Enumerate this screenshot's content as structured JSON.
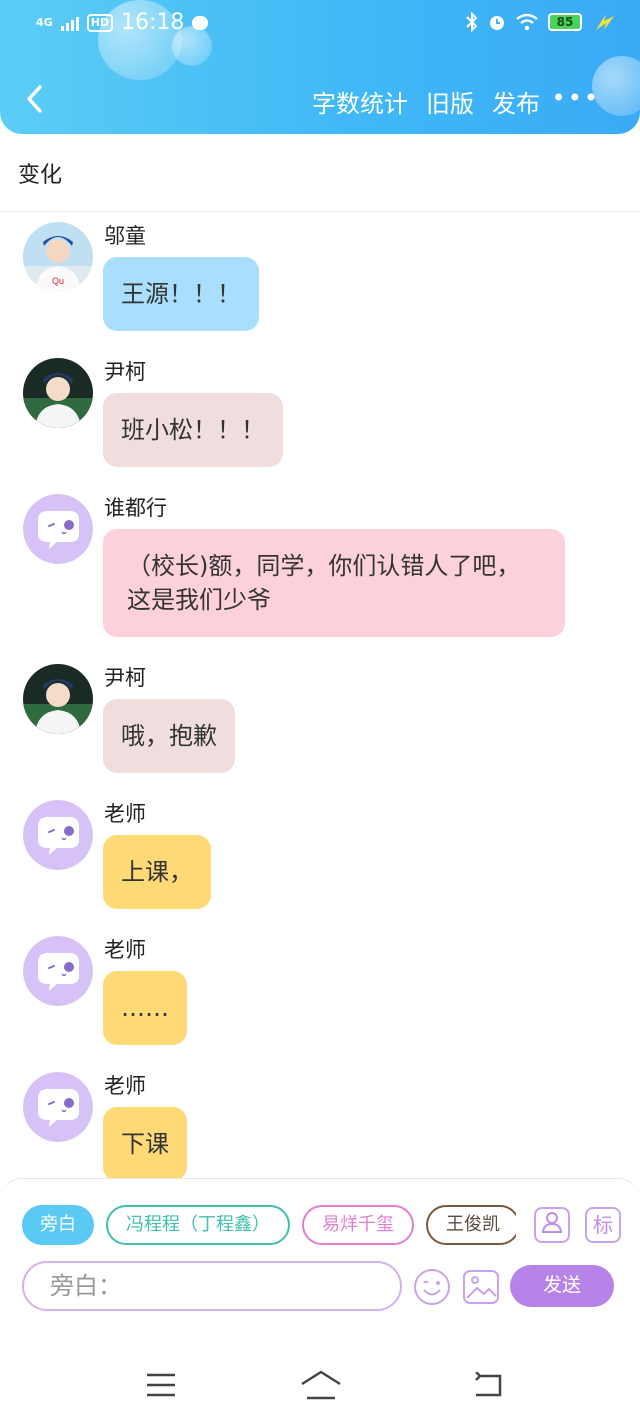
{
  "status_bar": {
    "network": "4G",
    "hd": "HD",
    "time": "16:18",
    "battery": "85"
  },
  "nav": {
    "back": "back",
    "actions": [
      "字数统计",
      "旧版",
      "发布"
    ],
    "more": "•••"
  },
  "story_title": "变化",
  "messages": [
    {
      "sender": "邬童",
      "text": "王源！！！",
      "bubble_color": "#a9dffc",
      "avatar": "photo-avatar"
    },
    {
      "sender": "尹柯",
      "text": "班小松！！！",
      "bubble_color": "#f0dedf",
      "avatar": "photo-avatar"
    },
    {
      "sender": "谁都行",
      "text": "（校长)额，同学，你们认错人了吧，这是我们少爷",
      "bubble_color": "#fdd1dc",
      "avatar": "chat-bubble-avatar"
    },
    {
      "sender": "尹柯",
      "text": "哦，抱歉",
      "bubble_color": "#f0dedf",
      "avatar": "photo-avatar"
    },
    {
      "sender": "老师",
      "text": "上课，",
      "bubble_color": "#fdda75",
      "avatar": "chat-bubble-avatar"
    },
    {
      "sender": "老师",
      "text": "……",
      "bubble_color": "#fdda75",
      "avatar": "chat-bubble-avatar"
    },
    {
      "sender": "老师",
      "text": "下课",
      "bubble_color": "#fdda75",
      "avatar": "chat-bubble-avatar"
    }
  ],
  "composer": {
    "chips": [
      {
        "label": "旁白",
        "active": true,
        "color": "#5ac9f3"
      },
      {
        "label": "冯程程（丁程鑫）",
        "active": false,
        "color": "#3fbfae"
      },
      {
        "label": "易烊千玺",
        "active": false,
        "color": "#e27fd0"
      },
      {
        "label": "王俊凯",
        "active": false,
        "color": "#7a5a3e"
      }
    ],
    "tag_label": "标",
    "placeholder": "旁白：",
    "send_label": "发送"
  }
}
